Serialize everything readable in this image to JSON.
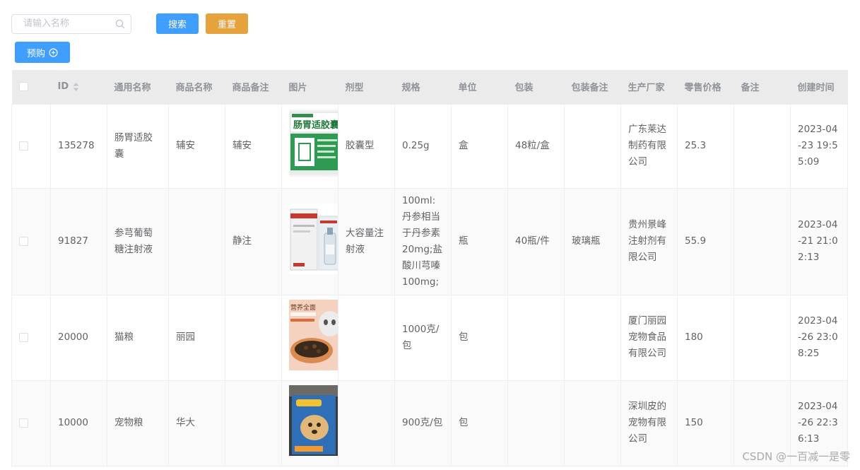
{
  "search": {
    "placeholder": "请输入名称",
    "value": ""
  },
  "buttons": {
    "search": "搜索",
    "reset": "重置",
    "preorder": "预购"
  },
  "colors": {
    "primary": "#409eff",
    "warning": "#e6a23c",
    "header_bg": "#ebebeb"
  },
  "table": {
    "columns": [
      "",
      "ID",
      "通用名称",
      "商品名称",
      "商品备注",
      "图片",
      "剂型",
      "规格",
      "单位",
      "包装",
      "包装备注",
      "生产厂家",
      "零售价格",
      "备注",
      "创建时间"
    ],
    "rows": [
      {
        "id": "135278",
        "generic_name": "肠胃适胶囊",
        "product_name": "辅安",
        "product_note": "辅安",
        "image": "capsule-box",
        "image_text": "肠胃适胶囊",
        "dosage_form": "胶囊型",
        "spec": "0.25g",
        "unit": "盒",
        "packing": "48粒/盒",
        "packing_note": "",
        "manufacturer": "广东莱达制药有限公司",
        "price": "25.3",
        "note": "",
        "created": "2023-04-23 19:55:09"
      },
      {
        "id": "91827",
        "generic_name": "参芎葡萄糖注射液",
        "product_name": "",
        "product_note": "静注",
        "image": "injection-box",
        "image_text": "",
        "dosage_form": "大容量注射液",
        "spec": "100ml:丹参相当于丹参素20mg;盐酸川芎嗪100mg;",
        "unit": "瓶",
        "packing": "40瓶/件",
        "packing_note": "玻璃瓶",
        "manufacturer": "贵州景峰注射剂有限公司",
        "price": "55.9",
        "note": "",
        "created": "2023-04-21 21:02:13"
      },
      {
        "id": "20000",
        "generic_name": "猫粮",
        "product_name": "丽园",
        "product_note": "",
        "image": "cat-food",
        "image_text": "营养全面",
        "dosage_form": "",
        "spec": "1000克/包",
        "unit": "包",
        "packing": "",
        "packing_note": "",
        "manufacturer": "厦门丽园宠物食品有限公司",
        "price": "180",
        "note": "",
        "created": "2023-04-26 23:08:25"
      },
      {
        "id": "10000",
        "generic_name": "宠物粮",
        "product_name": "华大",
        "product_note": "",
        "image": "pet-food-bag",
        "image_text": "",
        "dosage_form": "",
        "spec": "900克/包",
        "unit": "包",
        "packing": "",
        "packing_note": "",
        "manufacturer": "深圳皮的宠物有限公司",
        "price": "150",
        "note": "",
        "created": "2023-04-26 22:36:13"
      }
    ]
  },
  "watermark": "CSDN @一百减一是零"
}
